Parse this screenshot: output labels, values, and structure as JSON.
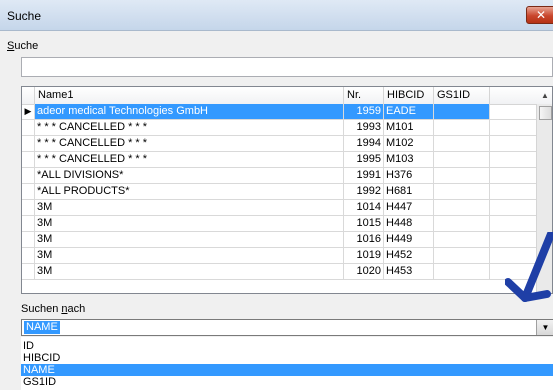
{
  "window": {
    "title": "Suche",
    "close_glyph": "✕"
  },
  "search": {
    "label_first": "S",
    "label_rest": "uche",
    "value": ""
  },
  "table": {
    "columns": [
      "Name1",
      "Nr.",
      "HIBCID",
      "GS1ID"
    ],
    "rows": [
      {
        "name": "adeor medical Technologies GmbH",
        "nr": "1959",
        "hibcid": "EADE",
        "gs1id": ""
      },
      {
        "name": "* * * CANCELLED * * *",
        "nr": "1993",
        "hibcid": "M101",
        "gs1id": ""
      },
      {
        "name": "* * * CANCELLED * * *",
        "nr": "1994",
        "hibcid": "M102",
        "gs1id": ""
      },
      {
        "name": "* * * CANCELLED * * *",
        "nr": "1995",
        "hibcid": "M103",
        "gs1id": ""
      },
      {
        "name": "*ALL DIVISIONS*",
        "nr": "1991",
        "hibcid": "H376",
        "gs1id": ""
      },
      {
        "name": "*ALL PRODUCTS*",
        "nr": "1992",
        "hibcid": "H681",
        "gs1id": ""
      },
      {
        "name": "3M",
        "nr": "1014",
        "hibcid": "H447",
        "gs1id": ""
      },
      {
        "name": "3M",
        "nr": "1015",
        "hibcid": "H448",
        "gs1id": ""
      },
      {
        "name": "3M",
        "nr": "1016",
        "hibcid": "H449",
        "gs1id": ""
      },
      {
        "name": "3M",
        "nr": "1019",
        "hibcid": "H452",
        "gs1id": ""
      },
      {
        "name": "3M",
        "nr": "1020",
        "hibcid": "H453",
        "gs1id": ""
      }
    ]
  },
  "search_by": {
    "label_first": "Suchen ",
    "label_u": "n",
    "label_rest": "ach",
    "selected": "NAME",
    "options": [
      "ID",
      "HIBCID",
      "NAME",
      "GS1ID"
    ]
  },
  "glyphs": {
    "row_indicator": "▶",
    "scroll_up": "▲",
    "dropdown": "▼"
  },
  "colors": {
    "selection": "#3399ff",
    "annotation_arrow": "#1f3fa6"
  }
}
